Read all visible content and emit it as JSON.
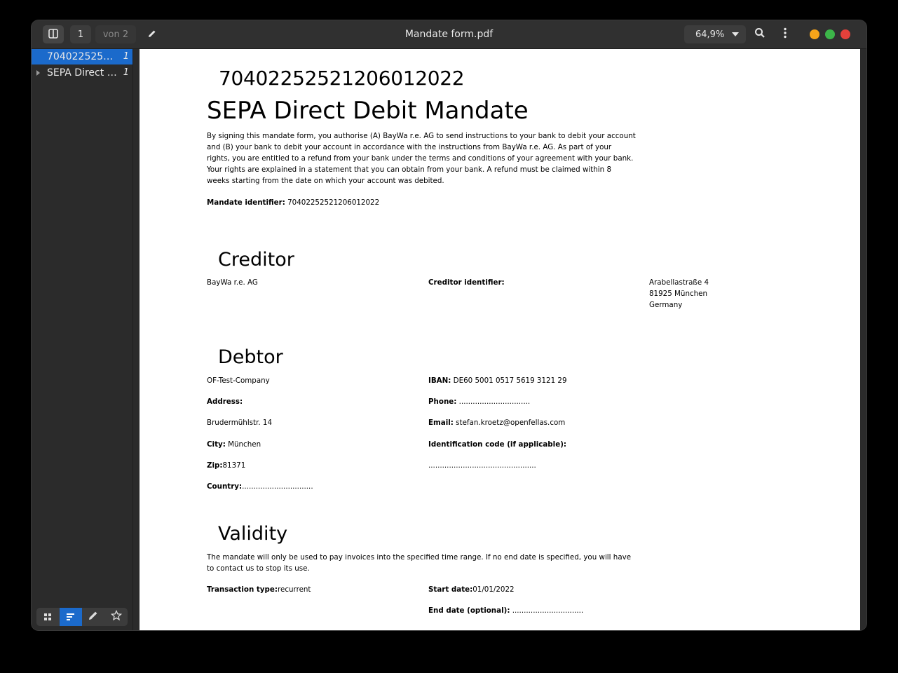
{
  "toolbar": {
    "page_number": "1",
    "page_of": "von 2",
    "title": "Mandate form.pdf",
    "zoom": "64,9%"
  },
  "sidebar": {
    "outline": [
      {
        "label": "70402252521206012022",
        "page": "1",
        "selected": true
      },
      {
        "label": "SEPA Direct Debit Mandate",
        "page": "1",
        "selected": false
      }
    ],
    "tabs": [
      "thumbnails-icon",
      "outline-icon",
      "annotations-icon",
      "bookmarks-icon"
    ]
  },
  "document": {
    "id_heading": "70402252521206012022",
    "title": "SEPA Direct Debit Mandate",
    "intro": "By signing this mandate form, you authorise (A) BayWa r.e. AG to send instructions to your bank to debit your account and (B) your bank to debit your account in accordance with the instructions from BayWa r.e. AG. As part of your rights, you are entitled to a refund from your bank under the terms and conditions of your agreement with your bank. Your rights are explained in a statement that you can obtain from your bank. A refund must be claimed within 8 weeks starting from the date on which your account was debited.",
    "mandate_id_label": "Mandate identifier:",
    "mandate_id_value": "70402252521206012022",
    "creditor": {
      "heading": "Creditor",
      "name": "BayWa r.e. AG",
      "identifier_label": "Creditor identifier:",
      "address_line1": "Arabellastraße 4",
      "address_line2": "81925 München",
      "address_line3": "Germany"
    },
    "debtor": {
      "heading": "Debtor",
      "company": "OF-Test-Company",
      "iban_label": "IBAN:",
      "iban_value": "DE60 5001 0517 5619 3121 29",
      "address_label": "Address:",
      "phone_label": "Phone:",
      "phone_value": "...............................",
      "street": "Brudermühlstr. 14",
      "email_label": "Email:",
      "email_value": "stefan.kroetz@openfellas.com",
      "city_label": "City:",
      "city_value": "München",
      "idcode_label": "Identification code (if applicable):",
      "zip_label": "Zip:",
      "zip_value": "81371",
      "idcode_value": "...............................................",
      "country_label": "Country:",
      "country_value": "...............................",
      "idcode_dots": ""
    },
    "validity": {
      "heading": "Validity",
      "text": "The mandate will only be used to pay invoices into the specified time range. If no end date is specified, you will have to contact us to stop its use.",
      "transaction_label": "Transaction type:",
      "transaction_value": "recurrent",
      "start_label": "Start date:",
      "start_value": "01/01/2022",
      "end_label": "End date (optional):",
      "end_value": "..............................."
    }
  }
}
